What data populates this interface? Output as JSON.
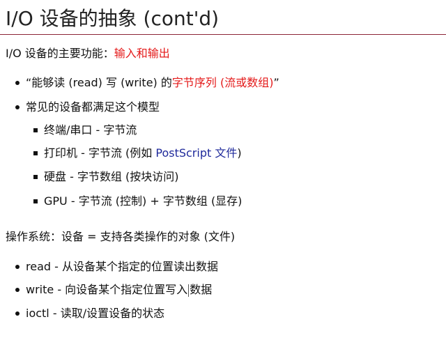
{
  "title": "I/O 设备的抽象 (cont'd)",
  "intro": {
    "prefix": "I/O 设备的主要功能：",
    "highlight": "输入和输出"
  },
  "bullets1": [
    {
      "prefix": "“能够读 (read) 写 (write) 的",
      "highlight": "字节序列 (流或数组)",
      "suffix": "”"
    },
    {
      "text": "常见的设备都满足这个模型"
    }
  ],
  "sub_bullets": [
    {
      "text": "终端/串口 - 字节流"
    },
    {
      "prefix": "打印机 - 字节流 (例如 ",
      "link": "PostScript 文件",
      "suffix": ")"
    },
    {
      "text": "硬盘 - 字节数组 (按块访问)"
    },
    {
      "text": "GPU - 字节流 (控制) + 字节数组 (显存)"
    }
  ],
  "os_line": "操作系统：设备 = 支持各类操作的对象 (文件)",
  "bullets2": [
    {
      "text": "read - 从设备某个指定的位置读出数据"
    },
    {
      "before_caret": "write - 向设备某个指定位置写入",
      "after_caret": "数据"
    },
    {
      "text": "ioctl - 读取/设置设备的状态"
    }
  ],
  "colors": {
    "highlight_red": "#e41a1a",
    "link_blue": "#1f2a9b",
    "title_rule": "#8b2336"
  }
}
